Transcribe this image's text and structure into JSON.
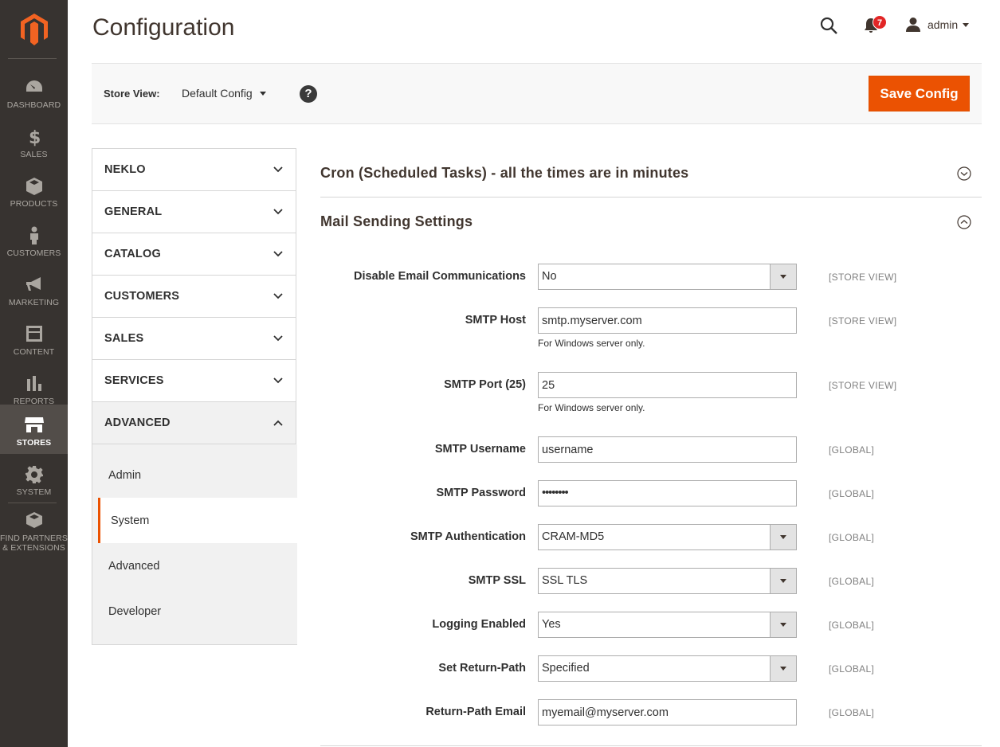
{
  "nav": {
    "items": [
      {
        "key": "dashboard",
        "label": "DASHBOARD"
      },
      {
        "key": "sales",
        "label": "SALES"
      },
      {
        "key": "products",
        "label": "PRODUCTS"
      },
      {
        "key": "customers",
        "label": "CUSTOMERS"
      },
      {
        "key": "marketing",
        "label": "MARKETING"
      },
      {
        "key": "content",
        "label": "CONTENT"
      },
      {
        "key": "reports",
        "label": "REPORTS"
      },
      {
        "key": "stores",
        "label": "STORES",
        "active": true
      },
      {
        "key": "system",
        "label": "SYSTEM"
      },
      {
        "key": "partners",
        "label": "FIND PARTNERS & EXTENSIONS"
      }
    ]
  },
  "header": {
    "title": "Configuration",
    "notifications_count": "7",
    "user_name": "admin"
  },
  "store_bar": {
    "label": "Store View:",
    "selected": "Default Config",
    "help": "?",
    "save_label": "Save Config"
  },
  "tabs": [
    {
      "label": "NEKLO"
    },
    {
      "label": "GENERAL"
    },
    {
      "label": "CATALOG"
    },
    {
      "label": "CUSTOMERS"
    },
    {
      "label": "SALES"
    },
    {
      "label": "SERVICES"
    },
    {
      "label": "ADVANCED",
      "open": true
    }
  ],
  "subtabs": [
    {
      "label": "Admin"
    },
    {
      "label": "System",
      "active": true
    },
    {
      "label": "Advanced"
    },
    {
      "label": "Developer"
    }
  ],
  "sections": {
    "cron_title": "Cron (Scheduled Tasks) - all the times are in minutes",
    "mail_title": "Mail Sending Settings"
  },
  "fields": [
    {
      "label": "Disable Email Communications",
      "value": "No",
      "type": "select",
      "scope": "[STORE VIEW]"
    },
    {
      "label": "SMTP Host",
      "value": "smtp.myserver.com",
      "type": "text",
      "scope": "[STORE VIEW]",
      "note": "For Windows server only."
    },
    {
      "label": "SMTP Port (25)",
      "value": "25",
      "type": "text",
      "scope": "[STORE VIEW]",
      "note": "For Windows server only."
    },
    {
      "label": "SMTP Username",
      "value": "username",
      "type": "text",
      "scope": "[GLOBAL]"
    },
    {
      "label": "SMTP Password",
      "value": "••••••••",
      "type": "password",
      "scope": "[GLOBAL]"
    },
    {
      "label": "SMTP Authentication",
      "value": "CRAM-MD5",
      "type": "select",
      "scope": "[GLOBAL]"
    },
    {
      "label": "SMTP SSL",
      "value": "SSL TLS",
      "type": "select",
      "scope": "[GLOBAL]"
    },
    {
      "label": "Logging Enabled",
      "value": "Yes",
      "type": "select",
      "scope": "[GLOBAL]"
    },
    {
      "label": "Set Return-Path",
      "value": "Specified",
      "type": "select",
      "scope": "[GLOBAL]"
    },
    {
      "label": "Return-Path Email",
      "value": "myemail@myserver.com",
      "type": "text",
      "scope": "[GLOBAL]"
    }
  ],
  "colors": {
    "accent": "#eb5202",
    "nav_bg": "#373330",
    "nav_active": "#524d49",
    "badge": "#e22626"
  }
}
